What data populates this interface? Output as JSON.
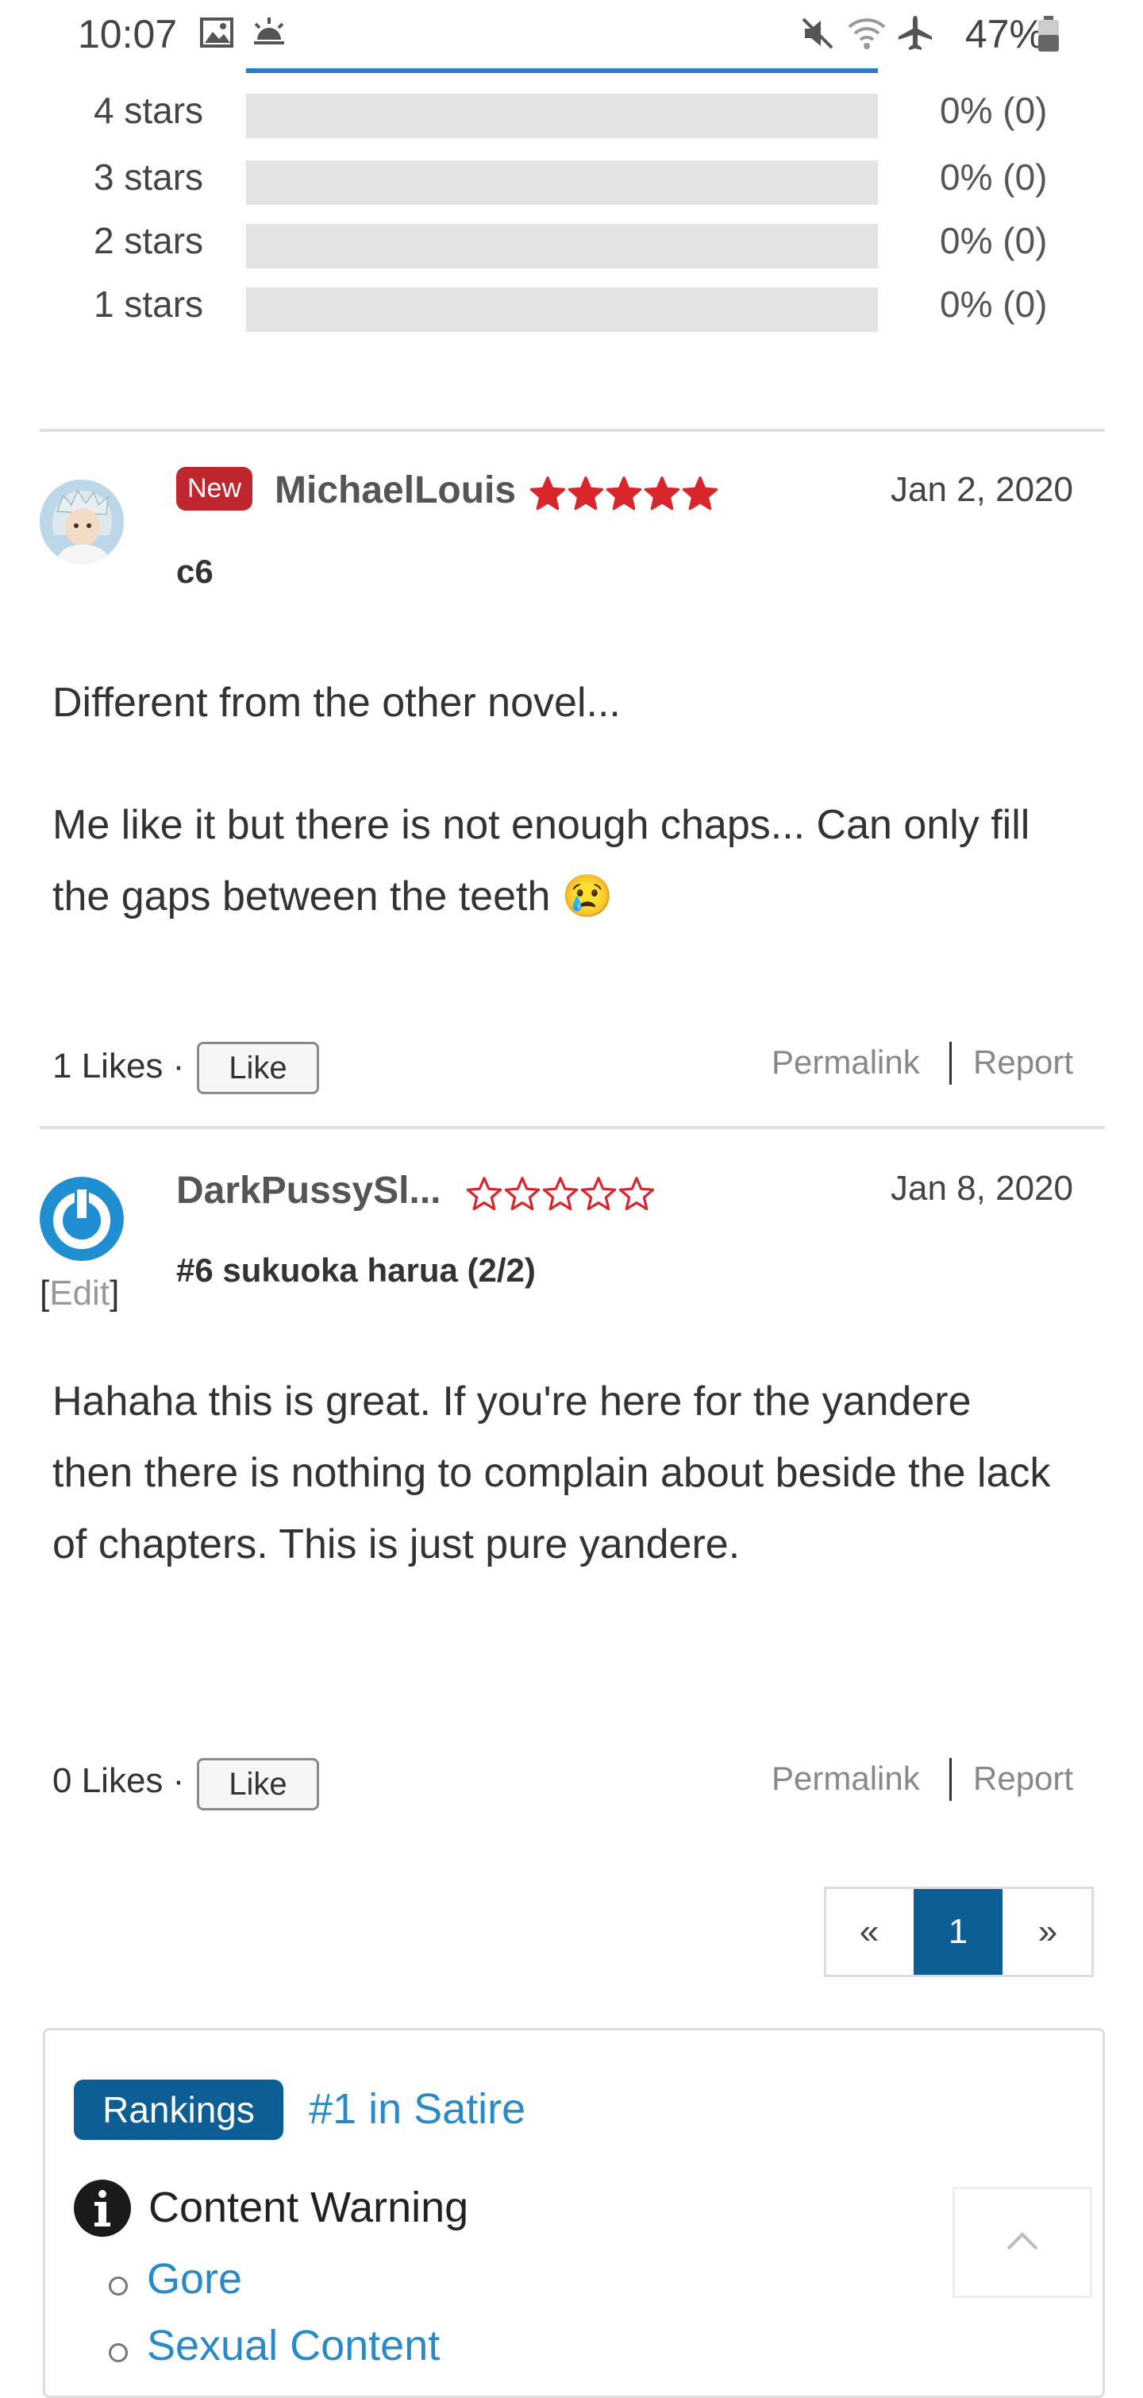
{
  "status_bar": {
    "time": "10:07",
    "battery": "47%"
  },
  "rating_breakdown": [
    {
      "label": "4 stars",
      "percent_text": "0% (0)",
      "fill": 0
    },
    {
      "label": "3 stars",
      "percent_text": "0% (0)",
      "fill": 0
    },
    {
      "label": "2 stars",
      "percent_text": "0% (0)",
      "fill": 0
    },
    {
      "label": "1 stars",
      "percent_text": "0% (0)",
      "fill": 0
    }
  ],
  "reviews": [
    {
      "badge": "New",
      "username": "MichaelLouis",
      "stars": 5,
      "date": "Jan 2, 2020",
      "subject": "c6",
      "paragraphs": [
        "Different from the other novel...",
        "Me like it but there is not enough chaps... Can only fill the gaps between the teeth 😢"
      ],
      "likes_text": "1 Likes ·",
      "like_label": "Like",
      "permalink": "Permalink",
      "report": "Report"
    },
    {
      "username": "DarkPussySl...",
      "stars": 0,
      "date": "Jan 8, 2020",
      "edit_open": "[",
      "edit_label": "Edit",
      "edit_close": "]",
      "subject": "#6 sukuoka harua (2/2)",
      "paragraphs": [
        "Hahaha this is great. If you're here for the yandere then there is nothing to complain about beside the lack of chapters. This is just pure yandere."
      ],
      "likes_text": "0 Likes ·",
      "like_label": "Like",
      "permalink": "Permalink",
      "report": "Report"
    }
  ],
  "pagination": {
    "prev": "«",
    "current": "1",
    "next": "»"
  },
  "rankings": {
    "badge": "Rankings",
    "link": "#1 in Satire"
  },
  "content_warning": {
    "title": "Content Warning",
    "items": [
      "Gore",
      "Sexual Content"
    ]
  },
  "colors": {
    "accent": "#2a7dc3",
    "badge_new": "#c0262d",
    "star_red": "#d9262c",
    "rank_badge": "#0e5e96",
    "pager_active": "#0e5e96"
  },
  "icons": {
    "back_to_top": "chevron-up-icon",
    "info": "info-icon"
  }
}
